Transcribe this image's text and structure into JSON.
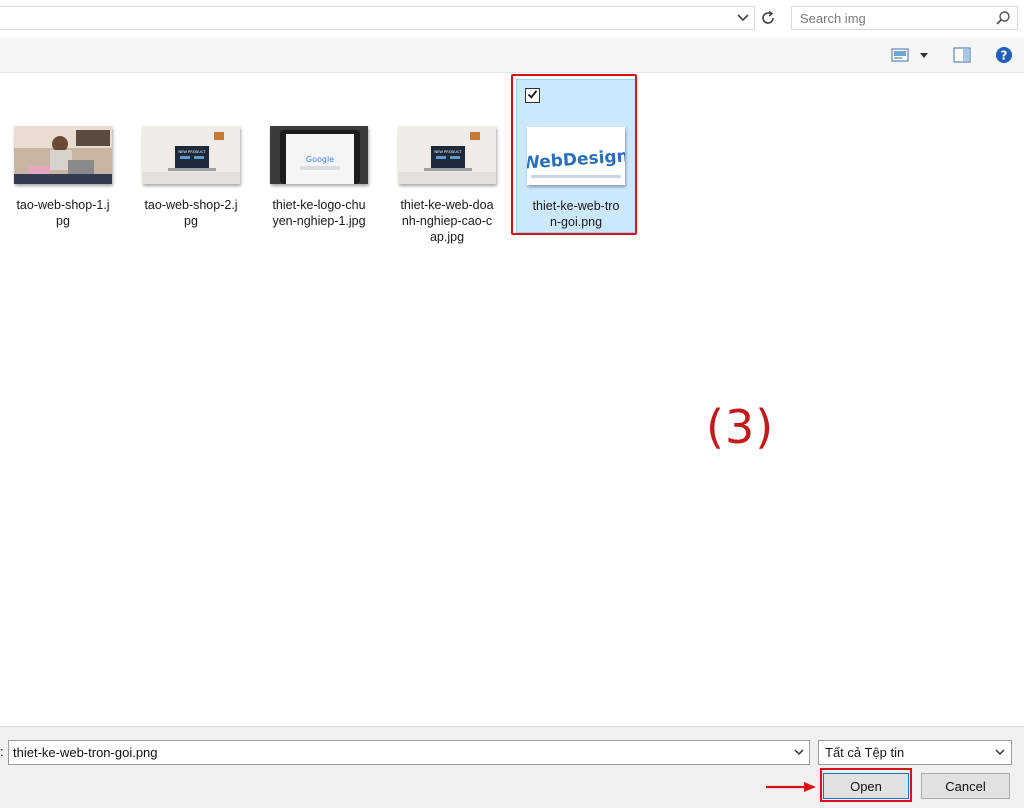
{
  "search": {
    "placeholder": "Search img"
  },
  "files": [
    {
      "name": "tao-web-shop-1.jpg",
      "display": "tao-web-shop-1.j\npg",
      "selected": false
    },
    {
      "name": "tao-web-shop-2.jpg",
      "display": "tao-web-shop-2.j\npg",
      "selected": false
    },
    {
      "name": "thiet-ke-logo-chuyen-nghiep-1.jpg",
      "display": "thiet-ke-logo-chu\nyen-nghiep-1.jpg",
      "selected": false
    },
    {
      "name": "thiet-ke-web-doanh-nghiep-cao-cap.jpg",
      "display": "thiet-ke-web-doa\nnh-nghiep-cao-c\nap.jpg",
      "selected": false
    },
    {
      "name": "thiet-ke-web-tron-goi.png",
      "display": "thiet-ke-web-tro\nn-goi.png",
      "selected": true
    }
  ],
  "thumbs": {
    "product_screen_text": "NEW PRODUCT",
    "google_text": "Google",
    "webdesign_text": "WebDesign"
  },
  "annotation": {
    "label": "(3)"
  },
  "bottom": {
    "filename_prefix": ":",
    "filename_value": "thiet-ke-web-tron-goi.png",
    "filetype_value": "Tất cả Tệp tin",
    "open_label": "Open",
    "cancel_label": "Cancel"
  },
  "colors": {
    "highlight": "#d6111a",
    "selection_bg": "#cce8ff",
    "annotation": "#c21a1a"
  }
}
